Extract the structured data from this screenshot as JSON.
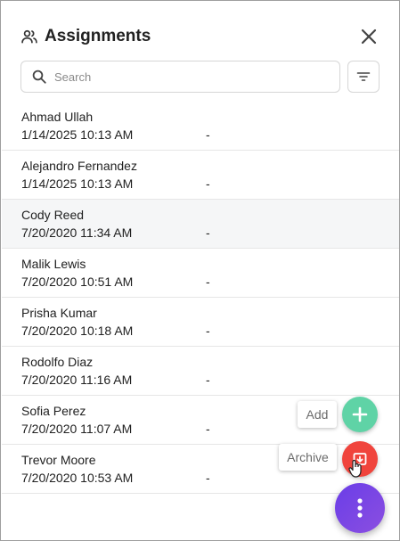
{
  "header": {
    "title": "Assignments",
    "title_icon": "people-icon",
    "close_icon": "close-icon"
  },
  "search": {
    "placeholder": "Search",
    "value": "",
    "icon": "search-icon",
    "filter_icon": "filter-icon"
  },
  "assignments": [
    {
      "name": "Ahmad Ullah",
      "date": "1/14/2025 10:13 AM",
      "status": "-"
    },
    {
      "name": "Alejandro Fernandez",
      "date": "1/14/2025 10:13 AM",
      "status": "-"
    },
    {
      "name": "Cody Reed",
      "date": "7/20/2020 11:34 AM",
      "status": "-"
    },
    {
      "name": "Malik Lewis",
      "date": "7/20/2020 10:51 AM",
      "status": "-"
    },
    {
      "name": "Prisha Kumar",
      "date": "7/20/2020 10:18 AM",
      "status": "-"
    },
    {
      "name": "Rodolfo Diaz",
      "date": "7/20/2020 11:16 AM",
      "status": "-"
    },
    {
      "name": "Sofia Perez",
      "date": "7/20/2020 11:07 AM",
      "status": "-"
    },
    {
      "name": "Trevor Moore",
      "date": "7/20/2020 10:53 AM",
      "status": "-"
    }
  ],
  "fab": {
    "add_label": "Add",
    "archive_label": "Archive",
    "add_icon": "plus-icon",
    "archive_icon": "archive-icon",
    "menu_icon": "more-vertical-icon"
  },
  "colors": {
    "add": "#5fd3a6",
    "archive": "#f0443c",
    "menu_start": "#6a3de8",
    "menu_end": "#8b4fe0",
    "selected_row": "#f5f6f7"
  }
}
